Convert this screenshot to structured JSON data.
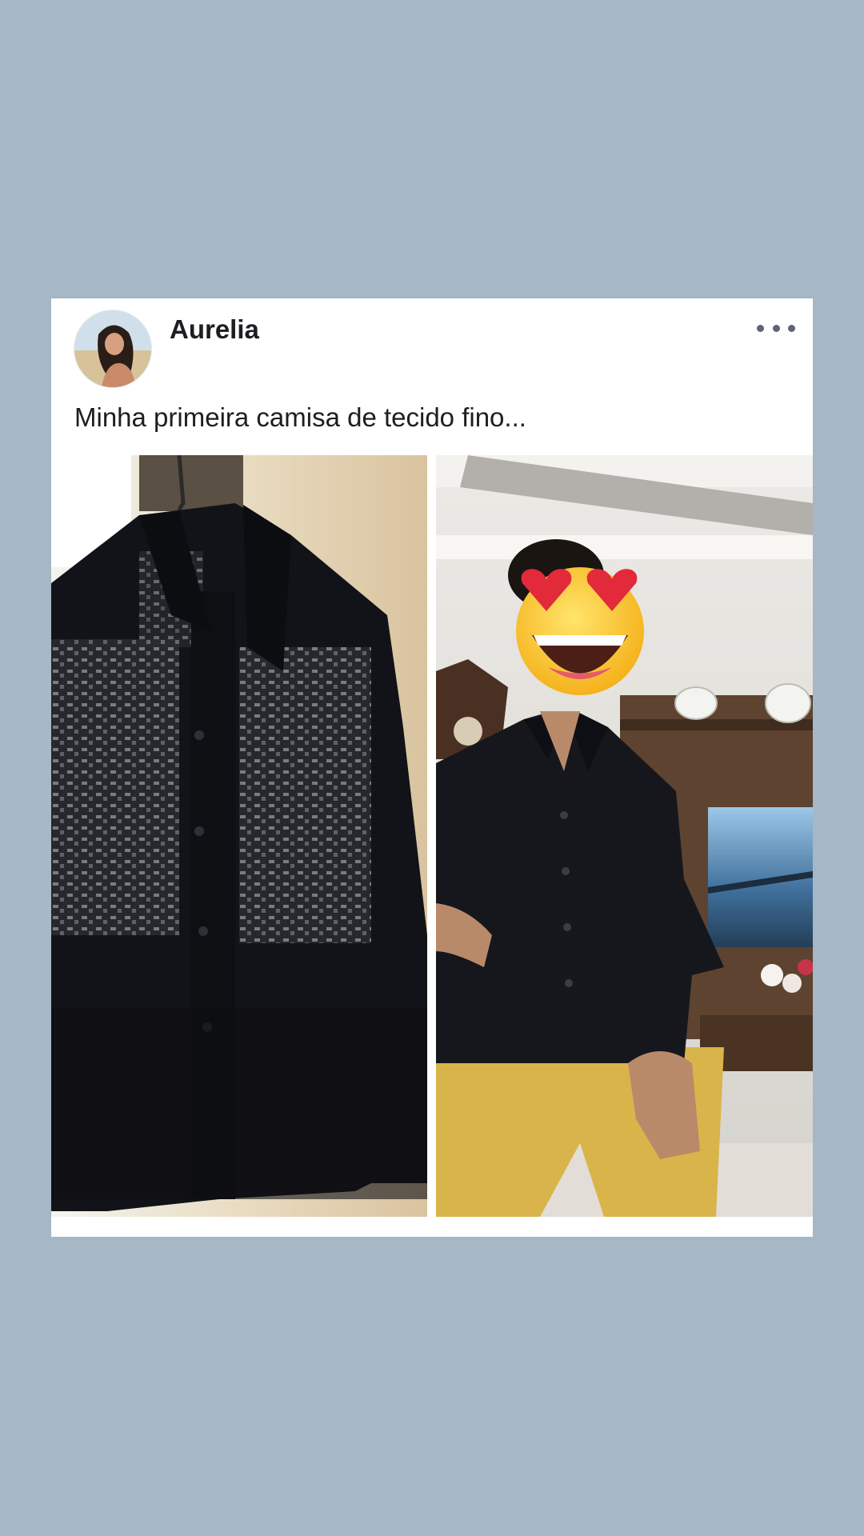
{
  "post": {
    "author": "Aurelia",
    "caption": "Minha primeira camisa de tecido fino...",
    "avatar_icon": "profile-photo",
    "more_icon": "more-horizontal-icon",
    "face_sticker_icon": "heart-eyes-emoji"
  },
  "colors": {
    "background": "#a6b7c6",
    "card": "#ffffff",
    "text": "#1c1e21",
    "shirt": "#14161c",
    "pants": "#d9b44a"
  }
}
